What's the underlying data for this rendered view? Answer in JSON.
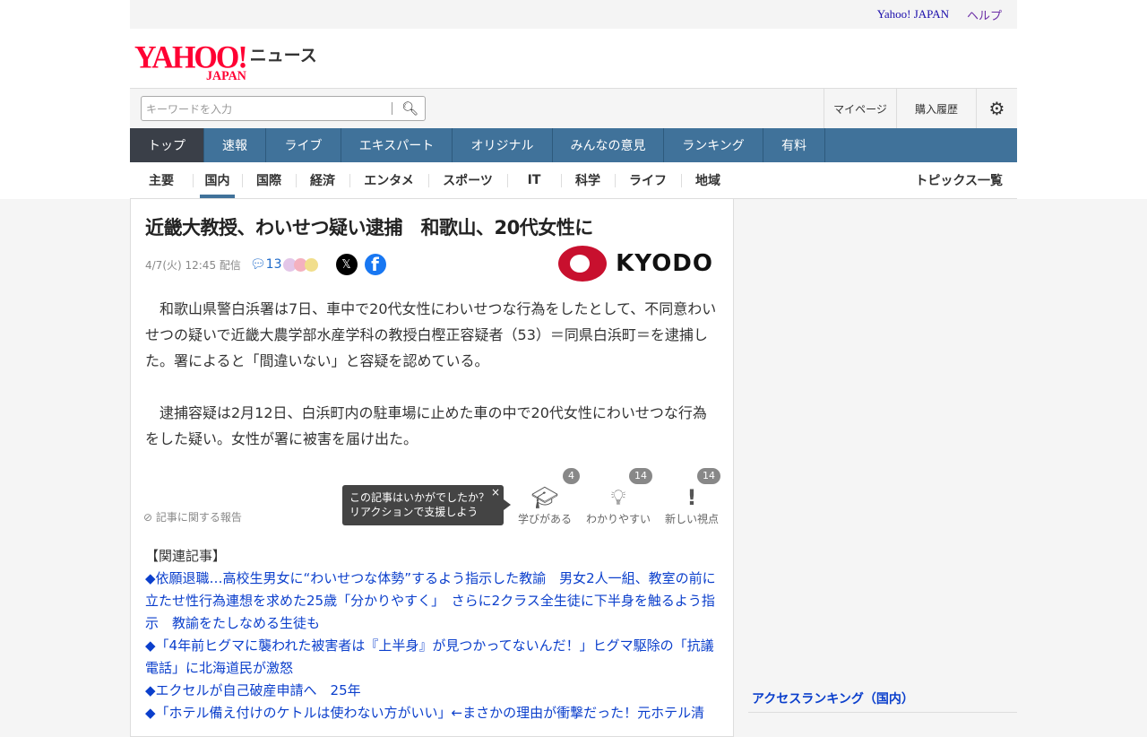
{
  "util": {
    "yahoo": "Yahoo! JAPAN",
    "help": "ヘルプ"
  },
  "logo": {
    "yahoo": "YAHOO!",
    "japan": "JAPAN",
    "news": "ニュース"
  },
  "search": {
    "placeholder": "キーワードを入力",
    "mypage": "マイページ",
    "history": "購入履歴"
  },
  "nav": [
    "トップ",
    "速報",
    "ライブ",
    "エキスパート",
    "オリジナル",
    "みんなの意見",
    "ランキング",
    "有料"
  ],
  "sub": [
    "主要",
    "国内",
    "国際",
    "経済",
    "エンタメ",
    "スポーツ",
    "IT",
    "科学",
    "ライフ",
    "地域"
  ],
  "topics": "トピックス一覧",
  "article": {
    "title": "近畿大教授、わいせつ疑い逮捕　和歌山、20代女性に",
    "date": "4/7(火) 12:45 配信",
    "comments": "13",
    "source": "KYODO",
    "paragraphs": [
      "和歌山県警白浜署は7日、車中で20代女性にわいせつな行為をしたとして、不同意わいせつの疑いで近畿大農学部水産学科の教授白樫正容疑者（53）＝同県白浜町＝を逮捕した。署によると「間違いない」と容疑を認めている。",
      "逮捕容疑は2月12日、白浜町内の駐車場に止めた車の中で20代女性にわいせつな行為をした疑い。女性が署に被害を届け出た。"
    ],
    "report": "記事に関する報告",
    "tooltip": {
      "line1": "この記事はいかがでしたか？",
      "line2": "リアクションで支援しよう",
      "close": "×"
    },
    "reactions": [
      {
        "label": "学びがある",
        "count": "4"
      },
      {
        "label": "わかりやすい",
        "count": "14"
      },
      {
        "label": "新しい視点",
        "count": "14"
      }
    ],
    "related_heading": "【関連記事】",
    "related": [
      "◆依願退職…高校生男女に“わいせつな体勢”するよう指示した教諭　男女2人一組、教室の前に立たせ性行為連想を求めた25歳「分かりやすく」　さらに2クラス全生徒に下半身を触るよう指示　教諭をたしなめる生徒も",
      "◆「4年前ヒグマに襲われた被害者は『上半身』が見つかってないんだ！」ヒグマ駆除の「抗議電話」に北海道民が激怒",
      "◆エクセルが自己破産申請へ　25年",
      "◆「ホテル備え付けのケトルは使わない方がいい」←まさかの理由が衝撃だった！元ホテル清"
    ]
  },
  "ranking": "アクセスランキング（国内）"
}
